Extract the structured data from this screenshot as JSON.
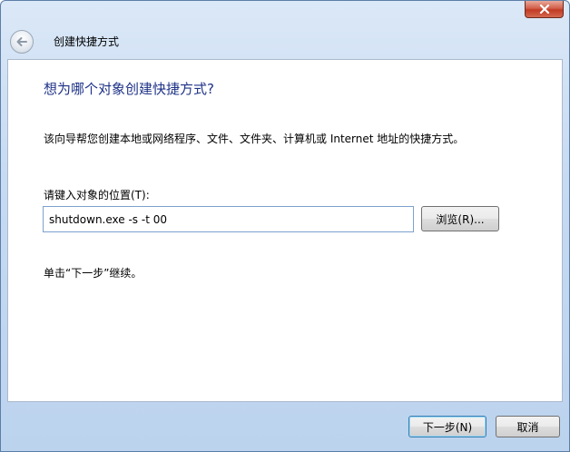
{
  "window": {
    "title": "创建快捷方式"
  },
  "icons": {
    "close": "close-icon",
    "back": "back-arrow-icon"
  },
  "wizard": {
    "question": "想为哪个对象创建快捷方式?",
    "description": "该向导帮您创建本地或网络程序、文件、文件夹、计算机或 Internet 地址的快捷方式。",
    "location_label": "请键入对象的位置(T):",
    "location_value": "shutdown.exe -s -t 00",
    "browse_label": "浏览(R)...",
    "hint": "单击“下一步”继续。"
  },
  "footer": {
    "next_label": "下一步(N)",
    "cancel_label": "取消"
  },
  "colors": {
    "question_text": "#1e3287",
    "close_button": "#c23a22",
    "input_border": "#7da2ce"
  }
}
